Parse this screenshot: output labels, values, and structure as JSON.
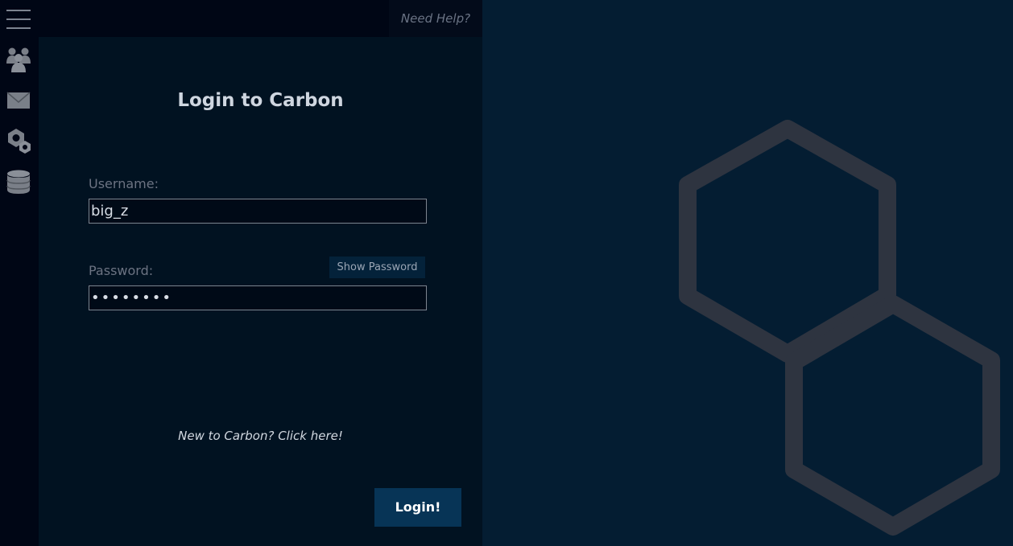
{
  "topbar": {
    "help_label": "Need Help?"
  },
  "sidebar": {
    "items": [
      {
        "icon": "hamburger-menu-icon"
      },
      {
        "icon": "users-group-icon"
      },
      {
        "icon": "mail-icon"
      },
      {
        "icon": "gears-icon"
      },
      {
        "icon": "database-icon"
      }
    ]
  },
  "login": {
    "title": "Login to Carbon",
    "username_label": "Username:",
    "username_value": "big_z",
    "password_label": "Password:",
    "password_value": "••••••••",
    "show_password_label": "Show Password",
    "new_user_link": "New to Carbon? Click here!",
    "submit_label": "Login!"
  },
  "colors": {
    "sidebar_bg": "#000615",
    "panel_bg": "#011221",
    "right_bg": "#041d32",
    "accent": "#073456",
    "hexagon": "#2e3440"
  }
}
